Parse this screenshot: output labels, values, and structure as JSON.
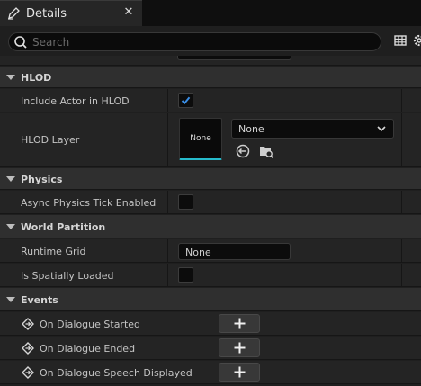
{
  "tab": {
    "title": "Details",
    "close_glyph": "✕",
    "icon": "pencil-icon"
  },
  "toolbar": {
    "search_placeholder": "Search",
    "icons": [
      "grid-view-icon",
      "settings-icon"
    ]
  },
  "sections": {
    "hlod": {
      "title": "HLOD",
      "include_actor_label": "Include Actor in HLOD",
      "include_actor_checked": true,
      "layer_label": "HLOD Layer",
      "layer_thumbnail_text": "None",
      "layer_value": "None"
    },
    "physics": {
      "title": "Physics",
      "async_tick_label": "Async Physics Tick Enabled",
      "async_tick_checked": false
    },
    "world_partition": {
      "title": "World Partition",
      "runtime_grid_label": "Runtime Grid",
      "runtime_grid_value": "None",
      "spatially_loaded_label": "Is Spatially Loaded",
      "spatially_loaded_checked": false
    },
    "events": {
      "title": "Events",
      "items": [
        {
          "label": "On Dialogue Started"
        },
        {
          "label": "On Dialogue Ended"
        },
        {
          "label": "On Dialogue Speech Displayed"
        }
      ]
    }
  },
  "colors": {
    "accent": "#26bbcc",
    "check": "#3a8ee6",
    "background": "#1f1f1f"
  }
}
